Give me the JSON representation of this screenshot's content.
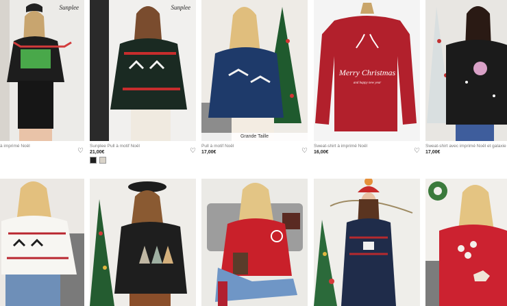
{
  "products": [
    {
      "name": "à imprimé Noël",
      "price": "",
      "brand": "Sunplee",
      "tag": ""
    },
    {
      "name": "Sunplee Pull à motif Noël",
      "price": "21,00€",
      "brand": "Sunplee",
      "tag": ""
    },
    {
      "name": "Pull à motif Noël",
      "price": "17,00€",
      "brand": "",
      "tag": "Grande Taille"
    },
    {
      "name": "Sweat-shirt à imprimé Noël",
      "price": "16,00€",
      "brand": "",
      "tag": "",
      "graphic_text": "Merry Christmas",
      "graphic_sub": "and happy new year"
    },
    {
      "name": "Sweat-shirt avec imprimé Noël et galaxie",
      "price": "17,00€",
      "brand": "",
      "tag": ""
    }
  ],
  "swatch_colors": [
    "#1f1f1f",
    "#d9d3c9"
  ],
  "icons": {
    "wishlist": "heart-outline-icon"
  }
}
